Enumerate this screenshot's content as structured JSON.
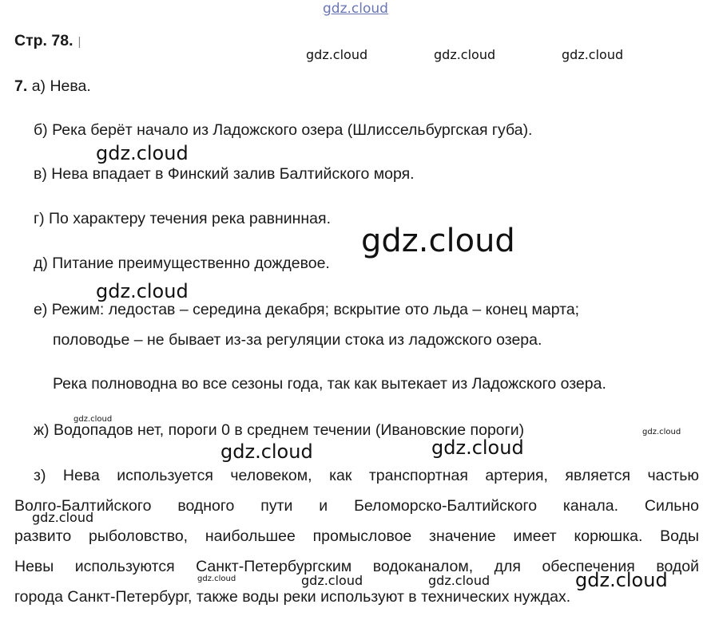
{
  "header": {
    "page_label": "Стр. 78.",
    "cursor_mark": "|"
  },
  "task": {
    "number": "7.",
    "items": {
      "a": "а) Нева.",
      "b": "б) Река берёт начало из Ладожского озера (Шлиссельбургская губа).",
      "v": "в) Нева впадает в Финский залив Балтийского моря.",
      "g": "г) По характеру течения река равнинная.",
      "d": "д) Питание преимущественно дождевое.",
      "e_line1": "е) Режим: ледостав – середина декабря; вскрытие ото льда – конец марта;",
      "e_line2": "половодье – не бывает из-за регуляции стока из ладожского озера.",
      "e_line3": "Река полноводна во все сезоны года, так как вытекает из Ладожского озера.",
      "zh": "ж) Водопадов нет, пороги 0 в среднем течении (Ивановские пороги)",
      "z_line1": "з) Нева используется человеком, как транспортная артерия, является частью",
      "z_line2": "Волго-Балтийского водного пути и Беломорско-Балтийского канала. Сильно",
      "z_line3": "развито рыболовство, наибольшее промысловое значение имеет корюшка. Воды",
      "z_line4": "Невы используются Санкт-Петербургским водоканалом, для обеспечения водой",
      "z_line5": "города Санкт-Петербург, также воды реки используют в технических нуждах."
    }
  },
  "watermark": {
    "text": "gdz.cloud",
    "top_color": "#1a2a8a"
  }
}
